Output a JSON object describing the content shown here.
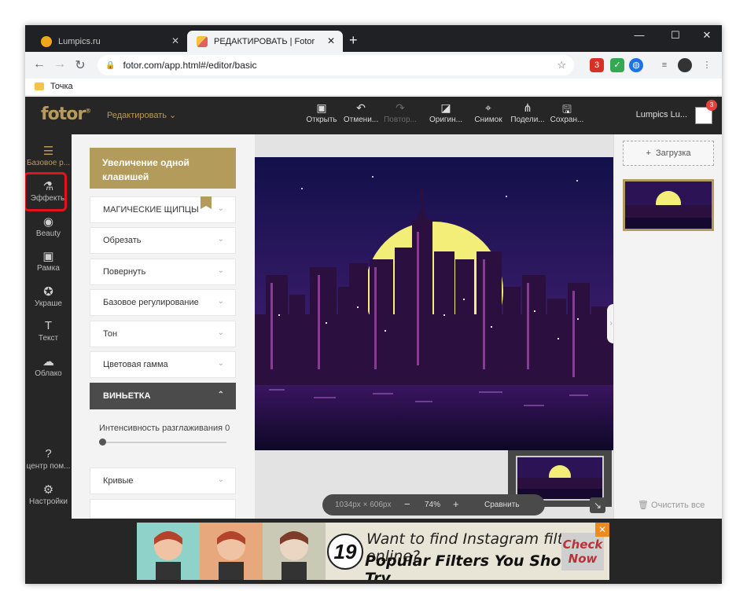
{
  "browser": {
    "tabs": [
      {
        "title": "Lumpics.ru",
        "favicon_color": "#f2a71b"
      },
      {
        "title": "РЕДАКТИРОВАТЬ | Fotor",
        "favicon_color": "#e35e5e"
      }
    ],
    "url": "fotor.com/app.html#/editor/basic",
    "bookmark": "Точка",
    "ext_badge": "3"
  },
  "fotor": {
    "logo": "fotor",
    "mode": "Редактировать",
    "tools": [
      "Открыть",
      "Отмени...",
      "Повтор...",
      "Оригин...",
      "Снимок",
      "Подели...",
      "Сохран..."
    ],
    "user": "Lumpics Lu...",
    "user_badge": "3",
    "left_nav": [
      "Базовое р...",
      "Эффекты",
      "Beauty",
      "Рамка",
      "Украше",
      "Текст",
      "Облако",
      "центр пом...",
      "Настройки"
    ],
    "panel": {
      "promo": "Увеличение одной клавишей",
      "sections": [
        "МАГИЧЕСКИЕ ЩИПЦЫ",
        "Обрезать",
        "Повернуть",
        "Базовое регулирование",
        "Тон",
        "Цветовая гамма",
        "ВИНЬЕТКА"
      ],
      "slider_label": "Интенсивность разглаживания 0",
      "slider_value": 0,
      "curves": "Кривые"
    },
    "canvas": {
      "size": "1034px × 606px",
      "zoom": "74%",
      "compare": "Сравнить",
      "minus": "−",
      "plus": "+"
    },
    "right": {
      "upload": "Загрузка",
      "clear": "Очистить все"
    }
  },
  "ad": {
    "number": "19",
    "line1": "Want to find Instagram filters online?",
    "line2": "Popular Filters You Should Try",
    "cta": "Check Now"
  }
}
